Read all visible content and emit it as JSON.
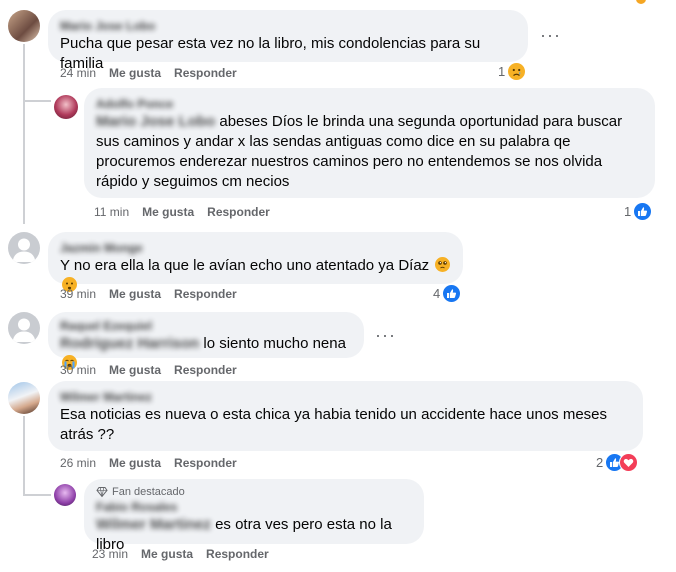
{
  "comments": [
    {
      "author": "Mario Jose Lobo",
      "text": "Pucha que pesar esta vez no la libro, mis condolencias para su familia",
      "time": "24 min",
      "like_label": "Me gusta",
      "reply_label": "Responder",
      "reaction_count": "1",
      "reactions": [
        "sad-icon"
      ]
    },
    {
      "author": "Adolfo Ponce",
      "tag": "Mario Jose Lobo",
      "text": "abeses Díos le brinda una segunda oportunidad para buscar sus caminos y andar x las sendas antiguas como dice en su palabra qe procuremos enderezar nuestros caminos pero no entendemos se nos olvida rápido y seguimos cm necios",
      "time": "11 min",
      "like_label": "Me gusta",
      "reply_label": "Responder",
      "reaction_count": "1",
      "reactions": [
        "like-icon"
      ]
    },
    {
      "author": "Jazmin Monge",
      "text": "Y no era ella la que le avían echo uno atentado ya Díaz",
      "emojis": [
        "pleading-face-icon",
        "worried-face-icon"
      ],
      "time": "39 min",
      "like_label": "Me gusta",
      "reply_label": "Responder",
      "reaction_count": "4",
      "reactions": [
        "like-icon"
      ]
    },
    {
      "author": "Raquel Ezequiel",
      "tag": "Rodriguez Harrison",
      "text": "lo siento mucho nena",
      "emojis": [
        "crying-face-icon"
      ],
      "time": "30 min",
      "like_label": "Me gusta",
      "reply_label": "Responder"
    },
    {
      "author": "Wilmer Martinez",
      "text": "Esa noticias es nueva o esta chica ya habia tenido un accidente hace unos meses atrás ??",
      "time": "26 min",
      "like_label": "Me gusta",
      "reply_label": "Responder",
      "reaction_count": "2",
      "reactions": [
        "like-icon",
        "love-icon"
      ]
    },
    {
      "badge": "Fan destacado",
      "author": "Fabio Rosales",
      "tag": "Wilmer Martinez",
      "text": "es otra ves pero esta no la libro",
      "time": "23 min",
      "like_label": "Me gusta",
      "reply_label": "Responder"
    }
  ],
  "more_label": "···",
  "colors": {
    "bubble": "#f0f2f5",
    "meta": "#65676b",
    "like": "#1877f2",
    "love": "#f33e58",
    "sad": "#f7b125"
  }
}
